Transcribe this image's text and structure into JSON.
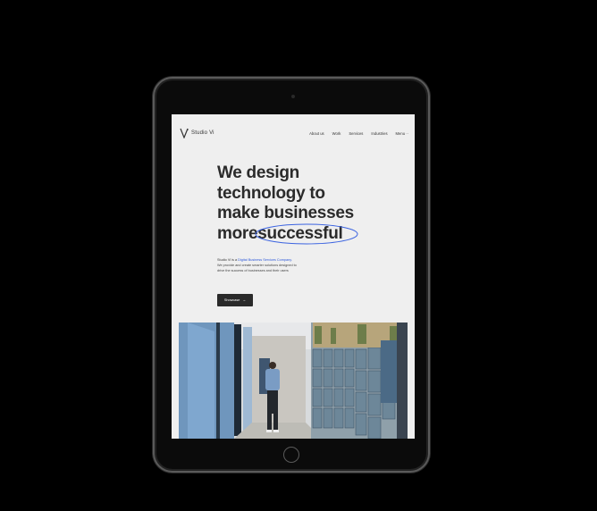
{
  "site": {
    "logo_text": "Studio Vi",
    "nav": [
      "About us",
      "Work",
      "Services",
      "Industries",
      "Menu"
    ],
    "menu_icon": "dots-icon"
  },
  "hero": {
    "line1": "We design",
    "line2": "technology  to",
    "line3": "make businesses",
    "line4_prefix": "more",
    "line4_highlight": "successful",
    "highlight_color": "#3b63e0"
  },
  "intro": {
    "prefix": "Studio Vi is a ",
    "link": "Digital Business Services Company.",
    "body": "We provide and create smarter solutions designed to drive the success of businesses and their users"
  },
  "cta": {
    "label": "Showcase",
    "icon": "arrow-right-icon"
  },
  "photo": {
    "subject": "person walking in office corridor with lockers"
  },
  "device": {
    "frame_color": "#0b0b0b",
    "screen_bg": "#efefef"
  }
}
